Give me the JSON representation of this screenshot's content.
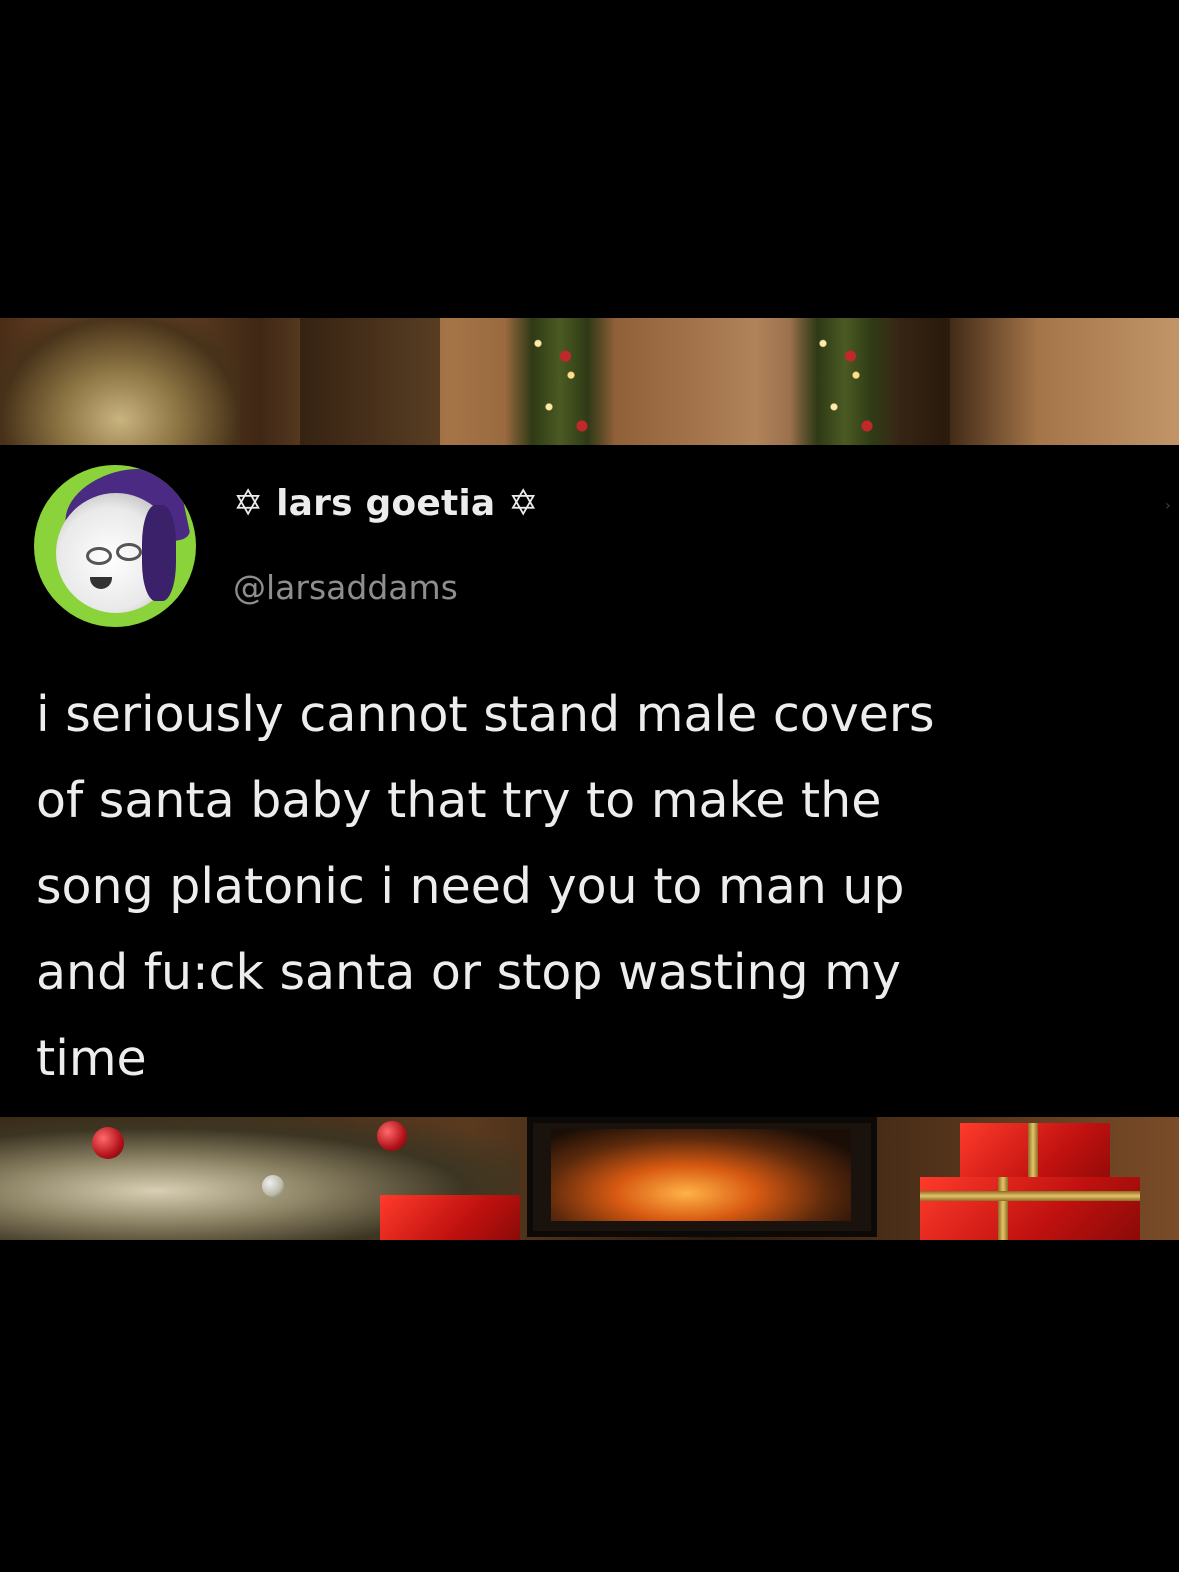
{
  "post": {
    "display_name_prefix": "✡",
    "display_name": "lars goetia",
    "display_name_suffix": "✡",
    "handle": "@larsaddams",
    "text": "i seriously cannot stand male covers\nof santa baby that try to make the\nsong platonic i need you to man up\nand fu:ck santa or stop wasting my\ntime"
  },
  "colors": {
    "background": "#000000",
    "text_primary": "#ededed",
    "text_secondary": "#8e8e8e",
    "avatar_ring": "#8ad33b",
    "avatar_hair": "#4a2a83"
  },
  "icons": {
    "avatar": "profile-avatar-icon",
    "name_decoration": "star-icon"
  }
}
